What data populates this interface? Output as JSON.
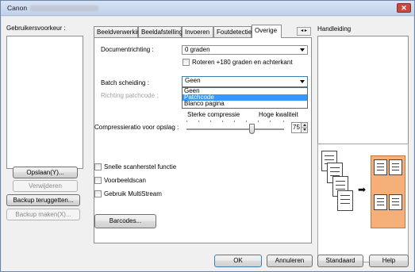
{
  "window": {
    "title": "Canon"
  },
  "left": {
    "title": "Gebruikersvoorkeur :",
    "save_btn": "Opslaan(Y)...",
    "delete_btn": "Verwijderen",
    "backup_restore_btn": "Backup teruggetten...",
    "backup_make_btn": "Backup maken(X)..."
  },
  "tabs": [
    "Beeldverwerking",
    "Beeldafstelling",
    "Invoeren",
    "Foutdetectie",
    "Overige"
  ],
  "active_tab": "Overige",
  "panel": {
    "doc_dir_label": "Documentrichting :",
    "doc_dir_value": "0 graden",
    "rotate_label": "Roteren +180 graden en achterkant",
    "batch_label": "Batch scheiding :",
    "batch_value": "Geen",
    "batch_options": [
      "Geen",
      "Patchcode",
      "Blanco pagina"
    ],
    "batch_selected": "Patchcode",
    "patch_dir_label": "Richting patchcode :",
    "strong_compress": "Sterke compressie",
    "high_quality": "Hoge kwaliteit",
    "compress_label": "Compressieratio voor opslag :",
    "compress_value": "75",
    "quick_recovery": "Snelle scanherstel functie",
    "preview_scan": "Voorbeeldscan",
    "multistream": "Gebruik MultiStream",
    "barcodes_btn": "Barcodes..."
  },
  "right": {
    "title": "Handleiding"
  },
  "bottom": {
    "ok": "OK",
    "cancel": "Annuleren",
    "default": "Standaard",
    "help": "Help"
  },
  "colors": {
    "selection": "#3399ff",
    "folder": "#f5b07a",
    "title_bg": "#bfd1ea"
  }
}
